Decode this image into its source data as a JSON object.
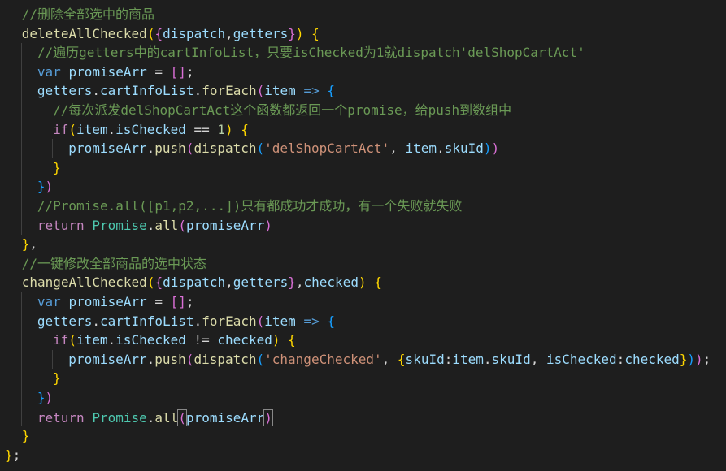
{
  "lines": [
    {
      "indent": 1,
      "tokens": [
        {
          "t": "//删除全部选中的商品",
          "c": "cm"
        }
      ]
    },
    {
      "indent": 1,
      "tokens": [
        {
          "t": "deleteAllChecked",
          "c": "fn"
        },
        {
          "t": "(",
          "c": "p1"
        },
        {
          "t": "{",
          "c": "p2"
        },
        {
          "t": "dispatch",
          "c": "vr"
        },
        {
          "t": ",",
          "c": "op"
        },
        {
          "t": "getters",
          "c": "vr"
        },
        {
          "t": "}",
          "c": "p2"
        },
        {
          "t": ")",
          "c": "p1"
        },
        {
          "t": " ",
          "c": "op"
        },
        {
          "t": "{",
          "c": "p1"
        }
      ]
    },
    {
      "indent": 2,
      "tokens": [
        {
          "t": "//遍历getters中的cartInfoList，只要isChecked为1就dispatch'delShopCartAct'",
          "c": "cm"
        }
      ]
    },
    {
      "indent": 2,
      "tokens": [
        {
          "t": "var",
          "c": "kw"
        },
        {
          "t": " ",
          "c": "op"
        },
        {
          "t": "promiseArr",
          "c": "vr"
        },
        {
          "t": " = ",
          "c": "op"
        },
        {
          "t": "[]",
          "c": "p2"
        },
        {
          "t": ";",
          "c": "op"
        }
      ]
    },
    {
      "indent": 2,
      "tokens": [
        {
          "t": "getters",
          "c": "vr"
        },
        {
          "t": ".",
          "c": "op"
        },
        {
          "t": "cartInfoList",
          "c": "vr"
        },
        {
          "t": ".",
          "c": "op"
        },
        {
          "t": "forEach",
          "c": "fn"
        },
        {
          "t": "(",
          "c": "p2"
        },
        {
          "t": "item",
          "c": "vr"
        },
        {
          "t": " ",
          "c": "op"
        },
        {
          "t": "=>",
          "c": "kw"
        },
        {
          "t": " ",
          "c": "op"
        },
        {
          "t": "{",
          "c": "p3"
        }
      ]
    },
    {
      "indent": 3,
      "tokens": [
        {
          "t": "//每次派发delShopCartAct这个函数都返回一个promise，给push到数组中",
          "c": "cm"
        }
      ]
    },
    {
      "indent": 3,
      "tokens": [
        {
          "t": "if",
          "c": "ct"
        },
        {
          "t": "(",
          "c": "p1"
        },
        {
          "t": "item",
          "c": "vr"
        },
        {
          "t": ".",
          "c": "op"
        },
        {
          "t": "isChecked",
          "c": "vr"
        },
        {
          "t": " == ",
          "c": "op"
        },
        {
          "t": "1",
          "c": "nm"
        },
        {
          "t": ")",
          "c": "p1"
        },
        {
          "t": " ",
          "c": "op"
        },
        {
          "t": "{",
          "c": "p1"
        }
      ]
    },
    {
      "indent": 4,
      "tokens": [
        {
          "t": "promiseArr",
          "c": "vr"
        },
        {
          "t": ".",
          "c": "op"
        },
        {
          "t": "push",
          "c": "fn"
        },
        {
          "t": "(",
          "c": "p2"
        },
        {
          "t": "dispatch",
          "c": "fn"
        },
        {
          "t": "(",
          "c": "p3"
        },
        {
          "t": "'delShopCartAct'",
          "c": "st"
        },
        {
          "t": ", ",
          "c": "op"
        },
        {
          "t": "item",
          "c": "vr"
        },
        {
          "t": ".",
          "c": "op"
        },
        {
          "t": "skuId",
          "c": "vr"
        },
        {
          "t": ")",
          "c": "p3"
        },
        {
          "t": ")",
          "c": "p2"
        }
      ]
    },
    {
      "indent": 3,
      "tokens": [
        {
          "t": "}",
          "c": "p1"
        }
      ]
    },
    {
      "indent": 2,
      "tokens": [
        {
          "t": "}",
          "c": "p3"
        },
        {
          "t": ")",
          "c": "p2"
        }
      ]
    },
    {
      "indent": 2,
      "tokens": [
        {
          "t": "//Promise.all([p1,p2,...])只有都成功才成功，有一个失败就失败",
          "c": "cm"
        }
      ]
    },
    {
      "indent": 2,
      "tokens": [
        {
          "t": "return",
          "c": "ct"
        },
        {
          "t": " ",
          "c": "op"
        },
        {
          "t": "Promise",
          "c": "cl"
        },
        {
          "t": ".",
          "c": "op"
        },
        {
          "t": "all",
          "c": "fn"
        },
        {
          "t": "(",
          "c": "p2"
        },
        {
          "t": "promiseArr",
          "c": "vr"
        },
        {
          "t": ")",
          "c": "p2"
        }
      ]
    },
    {
      "indent": 1,
      "tokens": [
        {
          "t": "}",
          "c": "p1"
        },
        {
          "t": ",",
          "c": "op"
        }
      ]
    },
    {
      "indent": 1,
      "tokens": [
        {
          "t": "//一键修改全部商品的选中状态",
          "c": "cm"
        }
      ]
    },
    {
      "indent": 1,
      "tokens": [
        {
          "t": "changeAllChecked",
          "c": "fn"
        },
        {
          "t": "(",
          "c": "p1"
        },
        {
          "t": "{",
          "c": "p2"
        },
        {
          "t": "dispatch",
          "c": "vr"
        },
        {
          "t": ",",
          "c": "op"
        },
        {
          "t": "getters",
          "c": "vr"
        },
        {
          "t": "}",
          "c": "p2"
        },
        {
          "t": ",",
          "c": "op"
        },
        {
          "t": "checked",
          "c": "vr"
        },
        {
          "t": ")",
          "c": "p1"
        },
        {
          "t": " ",
          "c": "op"
        },
        {
          "t": "{",
          "c": "p1"
        }
      ]
    },
    {
      "indent": 2,
      "tokens": [
        {
          "t": "var",
          "c": "kw"
        },
        {
          "t": " ",
          "c": "op"
        },
        {
          "t": "promiseArr",
          "c": "vr"
        },
        {
          "t": " = ",
          "c": "op"
        },
        {
          "t": "[]",
          "c": "p2"
        },
        {
          "t": ";",
          "c": "op"
        }
      ]
    },
    {
      "indent": 2,
      "tokens": [
        {
          "t": "getters",
          "c": "vr"
        },
        {
          "t": ".",
          "c": "op"
        },
        {
          "t": "cartInfoList",
          "c": "vr"
        },
        {
          "t": ".",
          "c": "op"
        },
        {
          "t": "forEach",
          "c": "fn"
        },
        {
          "t": "(",
          "c": "p2"
        },
        {
          "t": "item",
          "c": "vr"
        },
        {
          "t": " ",
          "c": "op"
        },
        {
          "t": "=>",
          "c": "kw"
        },
        {
          "t": " ",
          "c": "op"
        },
        {
          "t": "{",
          "c": "p3"
        }
      ]
    },
    {
      "indent": 3,
      "tokens": [
        {
          "t": "if",
          "c": "ct"
        },
        {
          "t": "(",
          "c": "p1"
        },
        {
          "t": "item",
          "c": "vr"
        },
        {
          "t": ".",
          "c": "op"
        },
        {
          "t": "isChecked",
          "c": "vr"
        },
        {
          "t": " != ",
          "c": "op"
        },
        {
          "t": "checked",
          "c": "vr"
        },
        {
          "t": ")",
          "c": "p1"
        },
        {
          "t": " ",
          "c": "op"
        },
        {
          "t": "{",
          "c": "p1"
        }
      ]
    },
    {
      "indent": 4,
      "tokens": [
        {
          "t": "promiseArr",
          "c": "vr"
        },
        {
          "t": ".",
          "c": "op"
        },
        {
          "t": "push",
          "c": "fn"
        },
        {
          "t": "(",
          "c": "p2"
        },
        {
          "t": "dispatch",
          "c": "fn"
        },
        {
          "t": "(",
          "c": "p3"
        },
        {
          "t": "'changeChecked'",
          "c": "st"
        },
        {
          "t": ", ",
          "c": "op"
        },
        {
          "t": "{",
          "c": "p1"
        },
        {
          "t": "skuId",
          "c": "vr"
        },
        {
          "t": ":",
          "c": "op"
        },
        {
          "t": "item",
          "c": "vr"
        },
        {
          "t": ".",
          "c": "op"
        },
        {
          "t": "skuId",
          "c": "vr"
        },
        {
          "t": ", ",
          "c": "op"
        },
        {
          "t": "isChecked",
          "c": "vr"
        },
        {
          "t": ":",
          "c": "op"
        },
        {
          "t": "checked",
          "c": "vr"
        },
        {
          "t": "}",
          "c": "p1"
        },
        {
          "t": ")",
          "c": "p3"
        },
        {
          "t": ")",
          "c": "p2"
        },
        {
          "t": ";",
          "c": "op"
        }
      ]
    },
    {
      "indent": 3,
      "tokens": [
        {
          "t": "}",
          "c": "p1"
        }
      ]
    },
    {
      "indent": 2,
      "tokens": [
        {
          "t": "}",
          "c": "p3"
        },
        {
          "t": ")",
          "c": "p2"
        }
      ]
    },
    {
      "indent": 2,
      "current": true,
      "tokens": [
        {
          "t": "return",
          "c": "ct"
        },
        {
          "t": " ",
          "c": "op"
        },
        {
          "t": "Promise",
          "c": "cl"
        },
        {
          "t": ".",
          "c": "op"
        },
        {
          "t": "all",
          "c": "fn"
        },
        {
          "t": "(",
          "c": "p2",
          "m": true
        },
        {
          "t": "promiseArr",
          "c": "vr"
        },
        {
          "t": ")",
          "c": "p2",
          "m": true
        }
      ]
    },
    {
      "indent": 1,
      "tokens": [
        {
          "t": "}",
          "c": "p1"
        }
      ]
    },
    {
      "indent": 0,
      "tokens": [
        {
          "t": "}",
          "c": "p1"
        },
        {
          "t": ";",
          "c": "op"
        }
      ]
    }
  ],
  "colors": {
    "background": "#1e1e1e",
    "comment": "#6a9955",
    "function": "#dcdcaa",
    "variable": "#9cdcfe",
    "keyword": "#569cd6",
    "control": "#c586c0",
    "string": "#ce9178",
    "number": "#b5cea8",
    "class": "#4ec9b0",
    "bracket1": "#ffd700",
    "bracket2": "#da70d6",
    "bracket3": "#179fff"
  }
}
